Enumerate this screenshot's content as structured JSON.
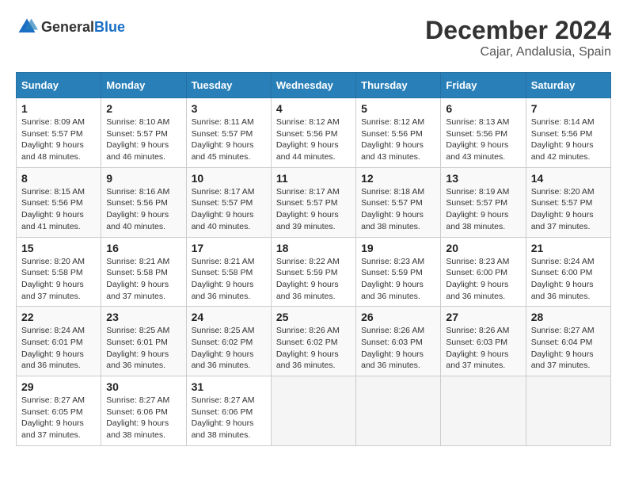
{
  "header": {
    "logo_general": "General",
    "logo_blue": "Blue",
    "main_title": "December 2024",
    "sub_title": "Cajar, Andalusia, Spain"
  },
  "calendar": {
    "days_of_week": [
      "Sunday",
      "Monday",
      "Tuesday",
      "Wednesday",
      "Thursday",
      "Friday",
      "Saturday"
    ],
    "weeks": [
      [
        {
          "day": "",
          "empty": true
        },
        {
          "day": "",
          "empty": true
        },
        {
          "day": "",
          "empty": true
        },
        {
          "day": "",
          "empty": true
        },
        {
          "day": "",
          "empty": true
        },
        {
          "day": "",
          "empty": true
        },
        {
          "day": "",
          "empty": true
        }
      ]
    ],
    "cells": [
      {
        "num": "1",
        "sunrise": "8:09 AM",
        "sunset": "5:57 PM",
        "daylight": "9 hours and 48 minutes."
      },
      {
        "num": "2",
        "sunrise": "8:10 AM",
        "sunset": "5:57 PM",
        "daylight": "9 hours and 46 minutes."
      },
      {
        "num": "3",
        "sunrise": "8:11 AM",
        "sunset": "5:57 PM",
        "daylight": "9 hours and 45 minutes."
      },
      {
        "num": "4",
        "sunrise": "8:12 AM",
        "sunset": "5:56 PM",
        "daylight": "9 hours and 44 minutes."
      },
      {
        "num": "5",
        "sunrise": "8:12 AM",
        "sunset": "5:56 PM",
        "daylight": "9 hours and 43 minutes."
      },
      {
        "num": "6",
        "sunrise": "8:13 AM",
        "sunset": "5:56 PM",
        "daylight": "9 hours and 43 minutes."
      },
      {
        "num": "7",
        "sunrise": "8:14 AM",
        "sunset": "5:56 PM",
        "daylight": "9 hours and 42 minutes."
      },
      {
        "num": "8",
        "sunrise": "8:15 AM",
        "sunset": "5:56 PM",
        "daylight": "9 hours and 41 minutes."
      },
      {
        "num": "9",
        "sunrise": "8:16 AM",
        "sunset": "5:56 PM",
        "daylight": "9 hours and 40 minutes."
      },
      {
        "num": "10",
        "sunrise": "8:17 AM",
        "sunset": "5:57 PM",
        "daylight": "9 hours and 40 minutes."
      },
      {
        "num": "11",
        "sunrise": "8:17 AM",
        "sunset": "5:57 PM",
        "daylight": "9 hours and 39 minutes."
      },
      {
        "num": "12",
        "sunrise": "8:18 AM",
        "sunset": "5:57 PM",
        "daylight": "9 hours and 38 minutes."
      },
      {
        "num": "13",
        "sunrise": "8:19 AM",
        "sunset": "5:57 PM",
        "daylight": "9 hours and 38 minutes."
      },
      {
        "num": "14",
        "sunrise": "8:20 AM",
        "sunset": "5:57 PM",
        "daylight": "9 hours and 37 minutes."
      },
      {
        "num": "15",
        "sunrise": "8:20 AM",
        "sunset": "5:58 PM",
        "daylight": "9 hours and 37 minutes."
      },
      {
        "num": "16",
        "sunrise": "8:21 AM",
        "sunset": "5:58 PM",
        "daylight": "9 hours and 37 minutes."
      },
      {
        "num": "17",
        "sunrise": "8:21 AM",
        "sunset": "5:58 PM",
        "daylight": "9 hours and 36 minutes."
      },
      {
        "num": "18",
        "sunrise": "8:22 AM",
        "sunset": "5:59 PM",
        "daylight": "9 hours and 36 minutes."
      },
      {
        "num": "19",
        "sunrise": "8:23 AM",
        "sunset": "5:59 PM",
        "daylight": "9 hours and 36 minutes."
      },
      {
        "num": "20",
        "sunrise": "8:23 AM",
        "sunset": "6:00 PM",
        "daylight": "9 hours and 36 minutes."
      },
      {
        "num": "21",
        "sunrise": "8:24 AM",
        "sunset": "6:00 PM",
        "daylight": "9 hours and 36 minutes."
      },
      {
        "num": "22",
        "sunrise": "8:24 AM",
        "sunset": "6:01 PM",
        "daylight": "9 hours and 36 minutes."
      },
      {
        "num": "23",
        "sunrise": "8:25 AM",
        "sunset": "6:01 PM",
        "daylight": "9 hours and 36 minutes."
      },
      {
        "num": "24",
        "sunrise": "8:25 AM",
        "sunset": "6:02 PM",
        "daylight": "9 hours and 36 minutes."
      },
      {
        "num": "25",
        "sunrise": "8:26 AM",
        "sunset": "6:02 PM",
        "daylight": "9 hours and 36 minutes."
      },
      {
        "num": "26",
        "sunrise": "8:26 AM",
        "sunset": "6:03 PM",
        "daylight": "9 hours and 36 minutes."
      },
      {
        "num": "27",
        "sunrise": "8:26 AM",
        "sunset": "6:03 PM",
        "daylight": "9 hours and 37 minutes."
      },
      {
        "num": "28",
        "sunrise": "8:27 AM",
        "sunset": "6:04 PM",
        "daylight": "9 hours and 37 minutes."
      },
      {
        "num": "29",
        "sunrise": "8:27 AM",
        "sunset": "6:05 PM",
        "daylight": "9 hours and 37 minutes."
      },
      {
        "num": "30",
        "sunrise": "8:27 AM",
        "sunset": "6:06 PM",
        "daylight": "9 hours and 38 minutes."
      },
      {
        "num": "31",
        "sunrise": "8:27 AM",
        "sunset": "6:06 PM",
        "daylight": "9 hours and 38 minutes."
      }
    ]
  }
}
